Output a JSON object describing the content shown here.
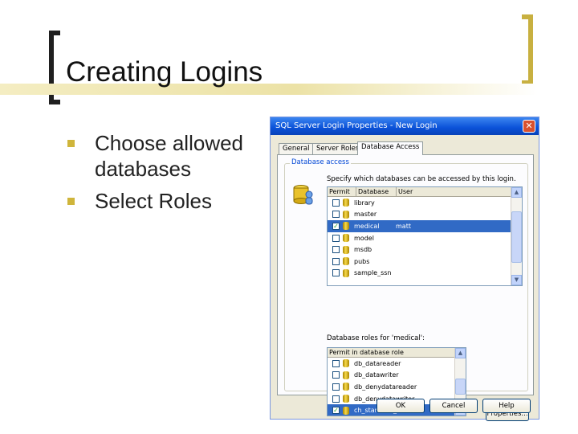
{
  "slide": {
    "title": "Creating Logins",
    "bullets": [
      "Choose allowed databases",
      "Select Roles"
    ]
  },
  "dialog": {
    "title": "SQL Server Login Properties - New Login",
    "tabs": [
      "General",
      "Server Roles",
      "Database Access"
    ],
    "group_label": "Database access",
    "instruction": "Specify which databases can be accessed by this login.",
    "db_list": {
      "headers": [
        "Permit",
        "Database",
        "User"
      ],
      "rows": [
        {
          "checked": false,
          "name": "library",
          "user": "",
          "selected": false
        },
        {
          "checked": false,
          "name": "master",
          "user": "",
          "selected": false
        },
        {
          "checked": true,
          "name": "medical",
          "user": "matt",
          "selected": true
        },
        {
          "checked": false,
          "name": "model",
          "user": "",
          "selected": false
        },
        {
          "checked": false,
          "name": "msdb",
          "user": "",
          "selected": false
        },
        {
          "checked": false,
          "name": "pubs",
          "user": "",
          "selected": false
        },
        {
          "checked": false,
          "name": "sample_ssn",
          "user": "",
          "selected": false
        }
      ]
    },
    "roles_label": "Database roles for 'medical':",
    "roles_list": {
      "headers": [
        "Permit in database role"
      ],
      "rows": [
        {
          "checked": false,
          "name": "db_datareader",
          "selected": false
        },
        {
          "checked": false,
          "name": "db_datawriter",
          "selected": false
        },
        {
          "checked": false,
          "name": "db_denydatareader",
          "selected": false
        },
        {
          "checked": false,
          "name": "db_denydatawriter",
          "selected": false
        },
        {
          "checked": true,
          "name": "ch_standard_user",
          "selected": true
        }
      ]
    },
    "buttons": {
      "properties": "Properties...",
      "ok": "OK",
      "cancel": "Cancel",
      "help": "Help"
    }
  },
  "colors": {
    "accent_bar": "#cfb53b",
    "selection": "#316ac5",
    "titlebar": "#0a51d8"
  }
}
